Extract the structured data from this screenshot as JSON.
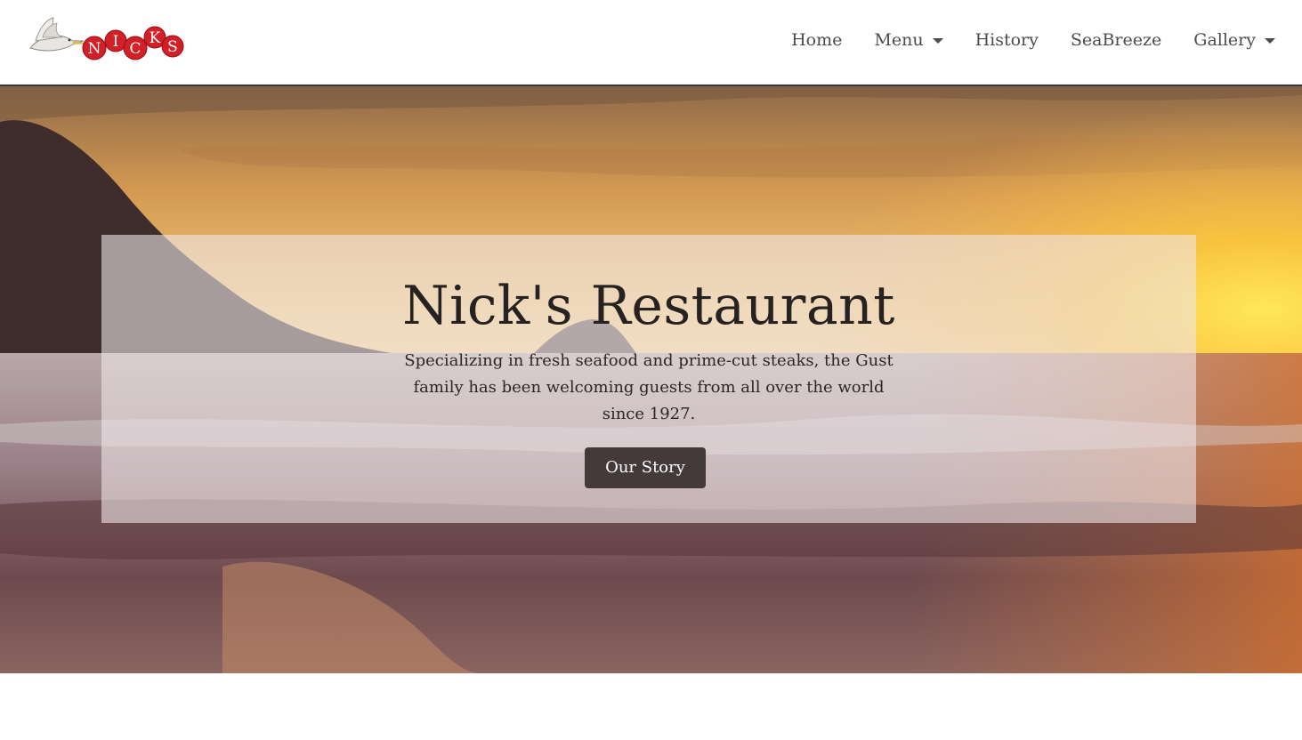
{
  "brand": {
    "logo_text": "NICKS",
    "logo_letters": [
      "N",
      "I",
      "C",
      "K",
      "S"
    ]
  },
  "nav": {
    "items": [
      {
        "label": "Home",
        "dropdown": false
      },
      {
        "label": "Menu",
        "dropdown": true
      },
      {
        "label": "History",
        "dropdown": false
      },
      {
        "label": "SeaBreeze",
        "dropdown": false
      },
      {
        "label": "Gallery",
        "dropdown": true
      }
    ]
  },
  "hero": {
    "title": "Nick's Restaurant",
    "description": "Specializing in fresh seafood and prime-cut steaks, the Gust family has been welcoming guests from all over the world since 1927.",
    "button_label": "Our Story",
    "background_image": "sunset over ocean with rocky headland"
  },
  "colors": {
    "nav_text": "#4d4b4b",
    "nav_border": "#3a3535",
    "title": "#262222",
    "button_bg": "#453a3b",
    "button_text": "#ffffff",
    "logo_red": "#d31f26"
  }
}
